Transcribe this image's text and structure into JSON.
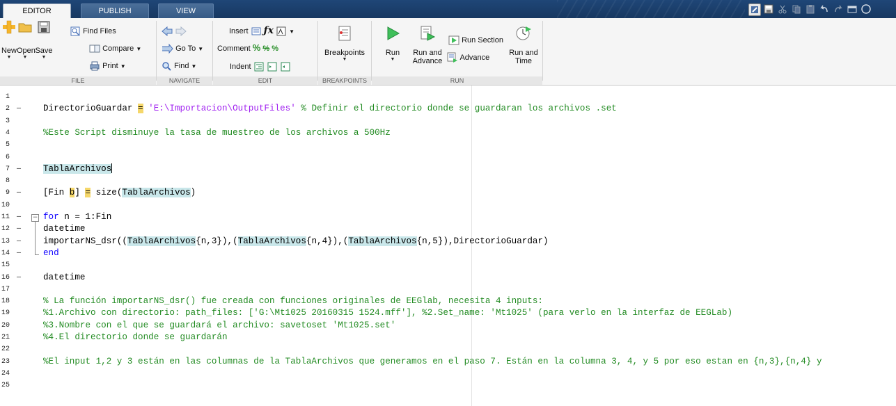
{
  "tabs": [
    {
      "label": "EDITOR",
      "active": true
    },
    {
      "label": "PUBLISH",
      "active": false
    },
    {
      "label": "VIEW",
      "active": false
    }
  ],
  "ribbon": {
    "file": {
      "group_label": "FILE",
      "new": "New",
      "open": "Open",
      "save": "Save",
      "find_files": "Find Files",
      "compare": "Compare",
      "print": "Print"
    },
    "navigate": {
      "group_label": "NAVIGATE",
      "go_to": "Go To",
      "find": "Find"
    },
    "edit": {
      "group_label": "EDIT",
      "insert": "Insert",
      "comment": "Comment",
      "indent": "Indent"
    },
    "breakpoints": {
      "group_label": "BREAKPOINTS",
      "breakpoints": "Breakpoints"
    },
    "run": {
      "group_label": "RUN",
      "run": "Run",
      "run_and_advance_1": "Run and",
      "run_and_advance_2": "Advance",
      "run_section": "Run Section",
      "advance": "Advance",
      "run_and_time_1": "Run and",
      "run_and_time_2": "Time"
    }
  },
  "editor": {
    "line_numbers": [
      "1",
      "2",
      "3",
      "4",
      "5",
      "6",
      "7",
      "8",
      "9",
      "10",
      "11",
      "12",
      "13",
      "14",
      "15",
      "16",
      "17",
      "18",
      "19",
      "20",
      "21",
      "22",
      "23",
      "24",
      "25"
    ],
    "executable_lines": [
      "2",
      "7",
      "9",
      "11",
      "12",
      "13",
      "14",
      "16"
    ],
    "code": {
      "l2_var": "DirectorioGuardar",
      "l2_eq": "=",
      "l2_str": "'E:\\Importacion\\OutputFiles'",
      "l2_cm": "% Definir el directorio donde se guardaran los archivos .set",
      "l4_cm": "%Este Script disminuye la tasa de muestreo de los archivos a 500Hz",
      "l7": "TablaArchivos",
      "l9_a": "[Fin ",
      "l9_b": "b",
      "l9_c": "] ",
      "l9_eq": "=",
      "l9_d": " size(",
      "l9_e": "TablaArchivos",
      "l9_f": ")",
      "l11_kw": "for",
      "l11_rest": " n = 1:Fin",
      "l12": "datetime",
      "l13_a": "importarNS_dsr((",
      "l13_t1": "TablaArchivos",
      "l13_b": "{n,3}),(",
      "l13_t2": "TablaArchivos",
      "l13_c": "{n,4}),(",
      "l13_t3": "TablaArchivos",
      "l13_d": "{n,5}),DirectorioGuardar)",
      "l14_kw": "end",
      "l16": "datetime",
      "l18_cm": "% La función importarNS_dsr() fue creada con funciones originales de EEGlab, necesita 4 inputs:",
      "l19_cm": "%1.Archivo con directorio: path_files: ['G:\\Mt1025 20160315 1524.mff'], %2.Set_name: 'Mt1025' (para verlo en la interfaz de EEGLab)",
      "l20_cm": "%3.Nombre con el que se guardará el archivo: savetoset 'Mt1025.set'",
      "l21_cm": "%4.El directorio donde se guardarán",
      "l23_cm": "%El input 1,2 y 3 están en las columnas de la TablaArchivos que generamos en el paso 7. Están en la columna 3, 4, y 5 por eso estan en {n,3},{n,4} y"
    }
  },
  "colors": {
    "tab_strip": "#1c3f6b",
    "ribbon_bg": "#f5f5f5",
    "keyword": "#0e00ff",
    "string": "#a020f0",
    "comment": "#228b22",
    "variable_highlight": "#c9e7ea",
    "warning_highlight": "#f5d76a"
  },
  "icons": [
    "new-icon",
    "open-icon",
    "save-icon",
    "find-files-icon",
    "compare-icon",
    "print-icon",
    "back-icon",
    "forward-icon",
    "go-to-icon",
    "find-icon",
    "insert-icon",
    "fx-icon",
    "comment-icon",
    "indent-icon",
    "breakpoints-icon",
    "run-icon",
    "run-and-advance-icon",
    "run-section-icon",
    "advance-icon",
    "run-and-time-icon"
  ]
}
